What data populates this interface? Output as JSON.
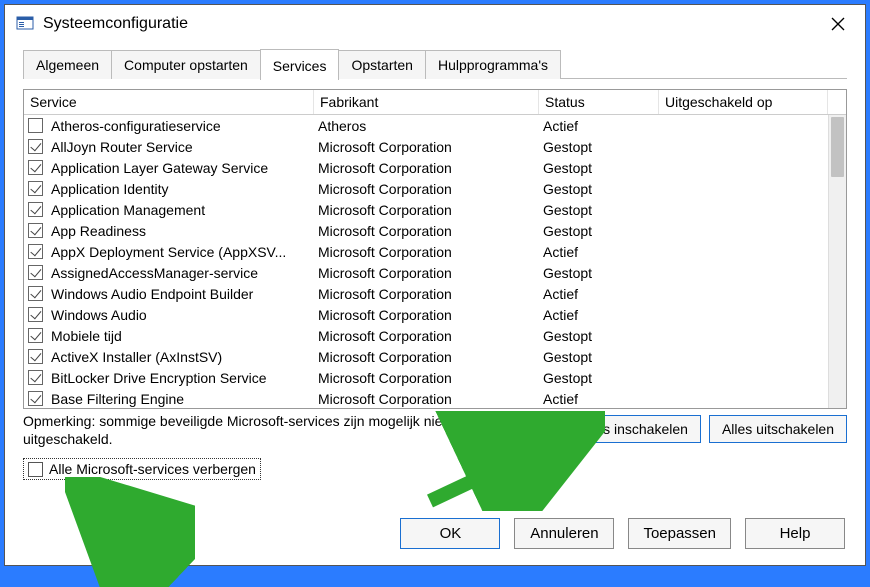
{
  "window": {
    "title": "Systeemconfiguratie"
  },
  "tabs": [
    {
      "label": "Algemeen"
    },
    {
      "label": "Computer opstarten"
    },
    {
      "label": "Services"
    },
    {
      "label": "Opstarten"
    },
    {
      "label": "Hulpprogramma's"
    }
  ],
  "columns": {
    "service": "Service",
    "manufacturer": "Fabrikant",
    "status": "Status",
    "disabled_on": "Uitgeschakeld op"
  },
  "services": [
    {
      "checked": false,
      "name": "Atheros-configuratieservice",
      "manufacturer": "Atheros",
      "status": "Actief"
    },
    {
      "checked": true,
      "name": "AllJoyn Router Service",
      "manufacturer": "Microsoft Corporation",
      "status": "Gestopt"
    },
    {
      "checked": true,
      "name": "Application Layer Gateway Service",
      "manufacturer": "Microsoft Corporation",
      "status": "Gestopt"
    },
    {
      "checked": true,
      "name": "Application Identity",
      "manufacturer": "Microsoft Corporation",
      "status": "Gestopt"
    },
    {
      "checked": true,
      "name": "Application Management",
      "manufacturer": "Microsoft Corporation",
      "status": "Gestopt"
    },
    {
      "checked": true,
      "name": "App Readiness",
      "manufacturer": "Microsoft Corporation",
      "status": "Gestopt"
    },
    {
      "checked": true,
      "name": "AppX Deployment Service (AppXSV...",
      "manufacturer": "Microsoft Corporation",
      "status": "Actief"
    },
    {
      "checked": true,
      "name": "AssignedAccessManager-service",
      "manufacturer": "Microsoft Corporation",
      "status": "Gestopt"
    },
    {
      "checked": true,
      "name": "Windows Audio Endpoint Builder",
      "manufacturer": "Microsoft Corporation",
      "status": "Actief"
    },
    {
      "checked": true,
      "name": "Windows Audio",
      "manufacturer": "Microsoft Corporation",
      "status": "Actief"
    },
    {
      "checked": true,
      "name": "Mobiele tijd",
      "manufacturer": "Microsoft Corporation",
      "status": "Gestopt"
    },
    {
      "checked": true,
      "name": "ActiveX Installer (AxInstSV)",
      "manufacturer": "Microsoft Corporation",
      "status": "Gestopt"
    },
    {
      "checked": true,
      "name": "BitLocker Drive Encryption Service",
      "manufacturer": "Microsoft Corporation",
      "status": "Gestopt"
    },
    {
      "checked": true,
      "name": "Base Filtering Engine",
      "manufacturer": "Microsoft Corporation",
      "status": "Actief"
    }
  ],
  "note": "Opmerking: sommige beveiligde Microsoft-services zijn mogelijk niet uitgeschakeld.",
  "hide_ms_label": "Alle Microsoft-services verbergen",
  "buttons": {
    "enable_all": "Alles inschakelen",
    "disable_all": "Alles uitschakelen",
    "ok": "OK",
    "cancel": "Annuleren",
    "apply": "Toepassen",
    "help": "Help"
  }
}
